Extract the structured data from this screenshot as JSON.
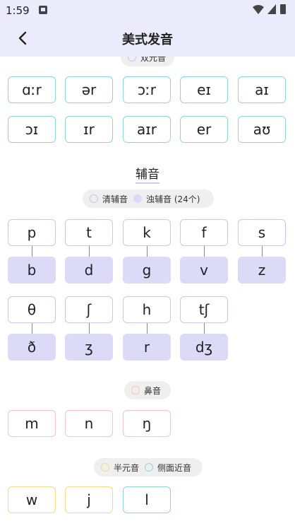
{
  "status_bar": {
    "time": "1:59"
  },
  "header": {
    "title": "美式发音"
  },
  "legend_top": {
    "label": "双元音"
  },
  "diphthongs": [
    "ɑːr",
    "ər",
    "ɔːr",
    "eɪ",
    "aɪ",
    "ɔɪ",
    "ɪr",
    "aɪr",
    "er",
    "aʊ"
  ],
  "consonants": {
    "title": "辅音",
    "legend": {
      "unvoiced_label": "清辅音",
      "voiced_label": "浊辅音 (24个)"
    },
    "pairs": [
      {
        "unvoiced": "p",
        "voiced": "b"
      },
      {
        "unvoiced": "t",
        "voiced": "d"
      },
      {
        "unvoiced": "k",
        "voiced": "g"
      },
      {
        "unvoiced": "f",
        "voiced": "v"
      },
      {
        "unvoiced": "s",
        "voiced": "z"
      },
      {
        "unvoiced": "θ",
        "voiced": "ð"
      },
      {
        "unvoiced": "ʃ",
        "voiced": "ʒ"
      },
      {
        "unvoiced": "h",
        "voiced": "r"
      },
      {
        "unvoiced": "tʃ",
        "voiced": "dʒ"
      }
    ]
  },
  "nasals": {
    "legend_label": "鼻音",
    "items": [
      "m",
      "n",
      "ŋ"
    ]
  },
  "semivowels": {
    "legend_semi": "半元音",
    "legend_lateral": "侧面近音",
    "items": [
      "w",
      "j",
      "l"
    ]
  },
  "colors": {
    "header_bg": "#ecebfb",
    "vowel_border": "#8fd6e0",
    "unvoiced_border": "#cbc6ea",
    "voiced_fill": "#dcdaf6",
    "nasal_border": "#f6c4c4",
    "semivowel_border": "#f5d98d",
    "lateral_border": "#8fd6e0"
  },
  "icons": {
    "back": "chevron-left-icon",
    "wifi": "wifi-icon",
    "signal": "signal-icon",
    "battery": "battery-icon",
    "sim": "sim-icon"
  }
}
